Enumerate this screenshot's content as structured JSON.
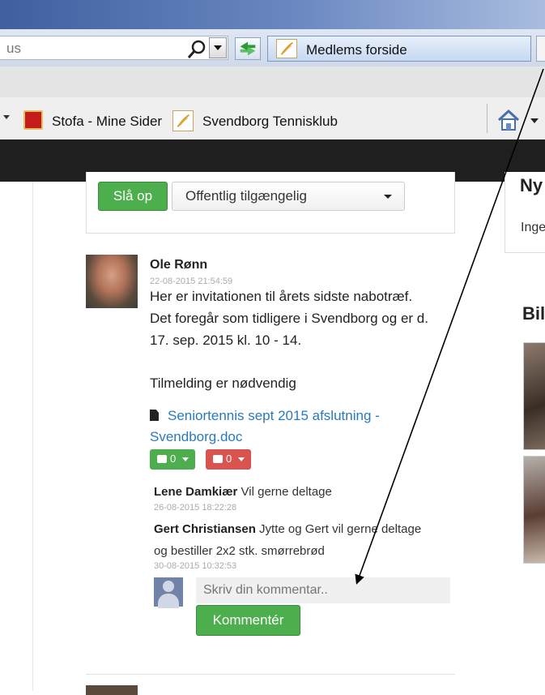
{
  "browser": {
    "address_value": "us",
    "tab_title": "Medlems forside",
    "favorites": [
      {
        "label": "Stofa - Mine Sider"
      },
      {
        "label": "Svendborg Tennisklub"
      }
    ]
  },
  "composer": {
    "submit_label": "Slå op",
    "visibility_selected": "Offentlig tilgængelig"
  },
  "post": {
    "author": "Ole Rønn",
    "timestamp": "22-08-2015 21:54:59",
    "lines": [
      "Her er invitationen til årets sidste nabotræf.",
      "Det foregår som tidligere i Svendborg og er d.",
      "17. sep. 2015 kl. 10 - 14.",
      "Tilmelding er nødvendig"
    ],
    "attachment_line1": "Seniortennis sept 2015 afslutning -",
    "attachment_line2": "Svendborg.doc",
    "likes": "0",
    "dislikes": "0"
  },
  "comments": [
    {
      "author": "Lene Damkiær",
      "text": "Vil gerne deltage",
      "timestamp": "26-08-2015 18:22:28"
    },
    {
      "author": "Gert Christiansen",
      "text": "Jytte og Gert vil gerne deltage",
      "text2": "og bestiller 2x2 stk. smørrebrød",
      "timestamp": "30-08-2015 10:32:53"
    }
  ],
  "comment_form": {
    "placeholder": "Skriv din kommentar..",
    "submit_label": "Kommentér"
  },
  "sidebar": {
    "box_title": "Ny",
    "box_text": "Inge",
    "gallery_title": "Bil"
  },
  "colors": {
    "green": "#4cae4c",
    "red": "#d9534f",
    "link": "#2a7ab8",
    "header": "#1f1f1f"
  }
}
